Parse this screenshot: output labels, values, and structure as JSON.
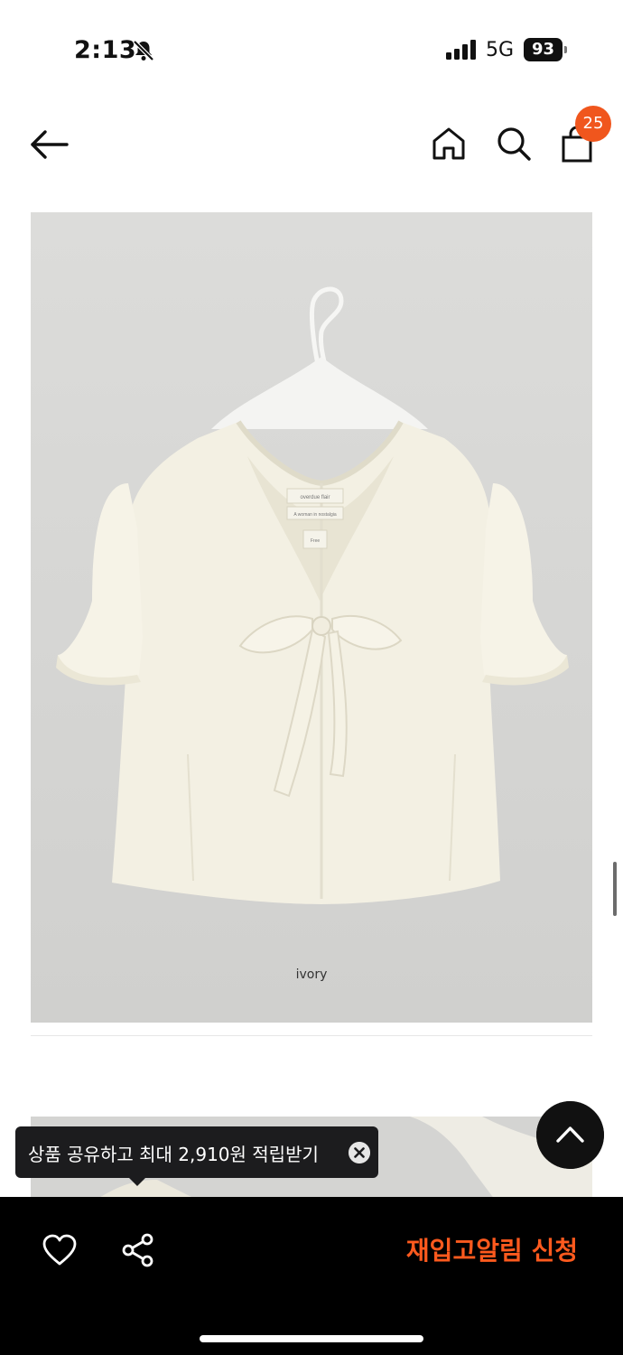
{
  "status_bar": {
    "time": "2:13",
    "network": "5G",
    "battery": "93",
    "icons": [
      "bell-slash-icon",
      "signal-icon"
    ]
  },
  "header": {
    "cart_count": "25",
    "icons": [
      "back-arrow-icon",
      "home-icon",
      "search-icon",
      "shopping-bag-icon"
    ]
  },
  "product": {
    "image_caption": "ivory",
    "label_lines": [
      "overdue flair",
      "A woman in nostalgia",
      "Free"
    ]
  },
  "tooltip": {
    "text": "상품 공유하고 최대 2,910원 적립받기",
    "close_icon": "close-circle-icon"
  },
  "bottom_bar": {
    "restock_label": "재입고알림 신청",
    "icons": [
      "heart-icon",
      "share-icon"
    ]
  },
  "colors": {
    "accent": "#ff5a1e",
    "badge": "#f0561d",
    "bar_background": "#000000",
    "photo_background": "#d7d7d5"
  }
}
